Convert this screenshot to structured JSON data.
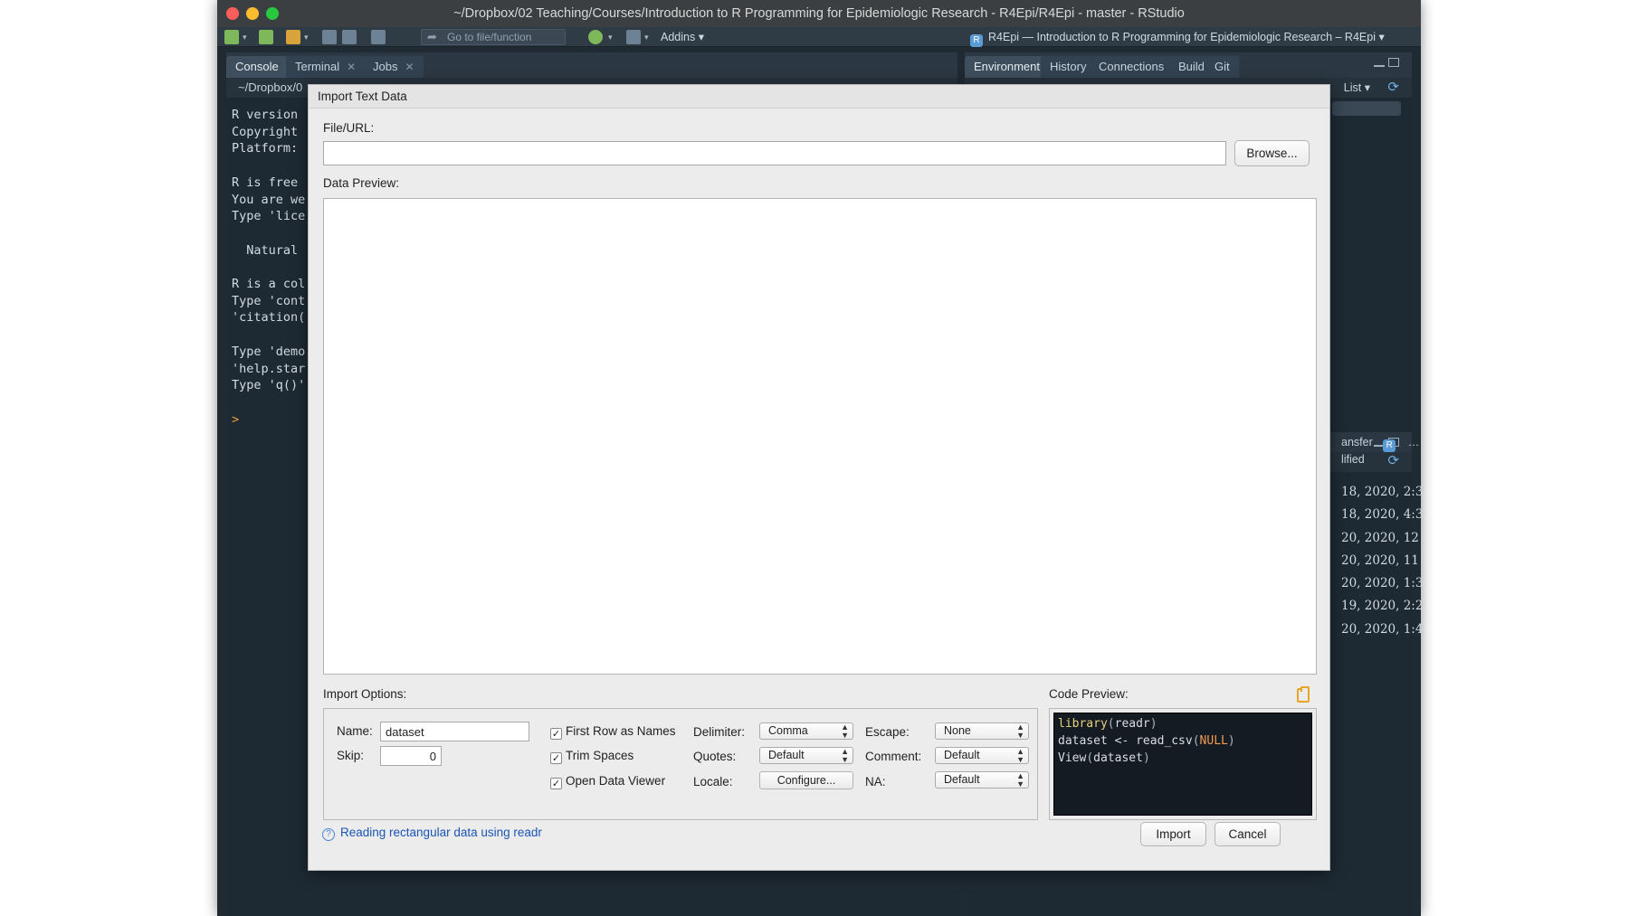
{
  "window": {
    "title": "~/Dropbox/02 Teaching/Courses/Introduction to R Programming for Epidemiologic Research - R4Epi/R4Epi - master - RStudio"
  },
  "toolbar": {
    "goto_placeholder": "Go to file/function",
    "addins": "Addins ▾",
    "project": "R4Epi — Introduction to R Programming for Epidemiologic Research – R4Epi ▾"
  },
  "left_pane": {
    "tabs": [
      "Console",
      "Terminal",
      "Jobs"
    ],
    "path": "~/Dropbox/0",
    "console_lines": [
      "R version",
      "Copyright",
      "Platform: ",
      "",
      "R is free ",
      "You are we",
      "Type 'lice",
      "",
      "  Natural ",
      "",
      "R is a col",
      "Type 'cont",
      "'citation(",
      "",
      "Type 'demo",
      "'help.star",
      "Type 'q()'"
    ],
    "prompt": ">"
  },
  "right_pane": {
    "tabs": [
      "Environment",
      "History",
      "Connections",
      "Build",
      "Git"
    ],
    "list_label": "List ▾",
    "transfer": "ansfer",
    "more": "…",
    "modified_header": "lified",
    "dates": [
      "18, 2020, 2:3",
      "18, 2020, 4:3",
      "20, 2020, 12",
      "20, 2020, 11",
      "20, 2020, 1:3",
      "19, 2020, 2:2",
      "20, 2020, 1:4"
    ]
  },
  "dialog": {
    "title": "Import Text Data",
    "file_url_label": "File/URL:",
    "file_url_value": "",
    "browse_button": "Browse...",
    "data_preview_label": "Data Preview:",
    "import_options_label": "Import Options:",
    "name_label": "Name:",
    "name_value": "dataset",
    "skip_label": "Skip:",
    "skip_value": "0",
    "checkboxes": {
      "first_row": {
        "label": "First Row as Names",
        "checked": true
      },
      "trim_spaces": {
        "label": "Trim Spaces",
        "checked": true
      },
      "open_viewer": {
        "label": "Open Data Viewer",
        "checked": true
      }
    },
    "delimiter_label": "Delimiter:",
    "delimiter_value": "Comma",
    "quotes_label": "Quotes:",
    "quotes_value": "Default",
    "locale_label": "Locale:",
    "locale_button": "Configure...",
    "escape_label": "Escape:",
    "escape_value": "None",
    "comment_label": "Comment:",
    "comment_value": "Default",
    "na_label": "NA:",
    "na_value": "Default",
    "code_preview_label": "Code Preview:",
    "code": {
      "line1_fn": "library",
      "line1_arg": "readr",
      "line2_var": "dataset <- ",
      "line2_fn": "read_csv",
      "line2_arg": "NULL",
      "line3_fn": "View",
      "line3_arg": "dataset"
    },
    "help_link": "Reading rectangular data using readr",
    "import_button": "Import",
    "cancel_button": "Cancel"
  },
  "colors": {
    "accent_link": "#1a55b5",
    "clipboard_icon": "#e5a526",
    "ide_background": "#1f2a33"
  }
}
